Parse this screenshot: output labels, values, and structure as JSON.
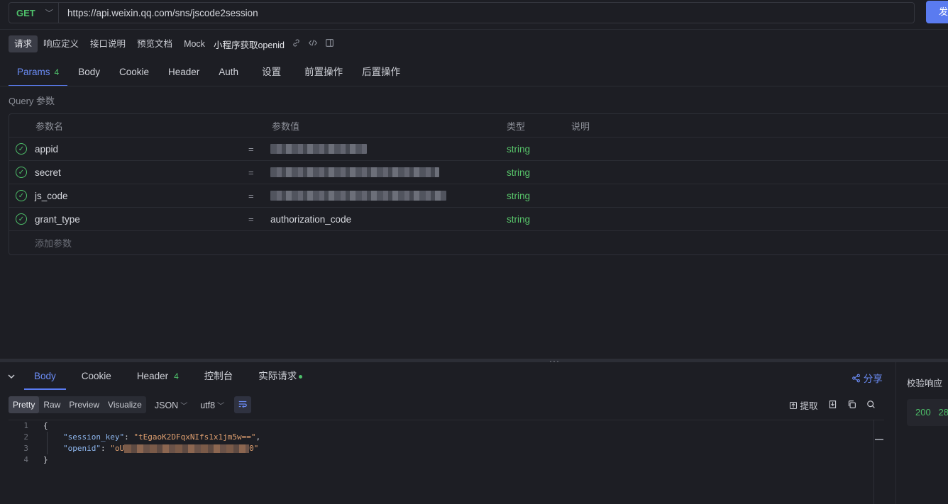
{
  "request": {
    "method": "GET",
    "url": "https://api.weixin.qq.com/sns/jscode2session",
    "send_label": "发"
  },
  "subtabs": [
    {
      "label": "请求",
      "active": true
    },
    {
      "label": "响应定义",
      "active": false
    },
    {
      "label": "接口说明",
      "active": false
    },
    {
      "label": "预览文档",
      "active": false
    },
    {
      "label": "Mock",
      "active": false
    }
  ],
  "request_name": "小程序获取openid",
  "param_tabs": [
    {
      "label": "Params",
      "badge": "4",
      "active": true
    },
    {
      "label": "Body"
    },
    {
      "label": "Cookie"
    },
    {
      "label": "Header"
    },
    {
      "label": "Auth"
    },
    {
      "label": "设置"
    },
    {
      "label": "前置操作"
    },
    {
      "label": "后置操作"
    }
  ],
  "query_label": "Query 参数",
  "table": {
    "headers": [
      "参数名",
      "参数值",
      "类型",
      "说明"
    ],
    "rows": [
      {
        "name": "appid",
        "value": "",
        "type": "string"
      },
      {
        "name": "secret",
        "value": "",
        "type": "string"
      },
      {
        "name": "js_code",
        "value": "",
        "type": "string"
      },
      {
        "name": "grant_type",
        "value": "authorization_code",
        "type": "string"
      }
    ],
    "add_placeholder": "添加参数"
  },
  "response": {
    "tabs": [
      {
        "label": "Body",
        "active": true
      },
      {
        "label": "Cookie"
      },
      {
        "label": "Header",
        "badge": "4"
      },
      {
        "label": "控制台"
      },
      {
        "label": "实际请求",
        "dot": true
      }
    ],
    "share_label": "分享",
    "formats": [
      "Pretty",
      "Raw",
      "Preview",
      "Visualize"
    ],
    "content_type": "JSON",
    "encoding": "utf8",
    "extract_label": "提取",
    "code_lines": [
      {
        "ln": "1",
        "text": "{"
      },
      {
        "ln": "2",
        "key": "\"session_key\"",
        "value": "\"tEgaoK2DFqxNIfs1x1jm5w==\"",
        "suffix": ","
      },
      {
        "ln": "3",
        "key": "\"openid\"",
        "value_prefix": "\"oU",
        "value_suffix": "0\""
      },
      {
        "ln": "4",
        "text": "}"
      }
    ]
  },
  "side": {
    "verify_label": "校验响应",
    "status_code": "200",
    "status_extra": "28"
  }
}
